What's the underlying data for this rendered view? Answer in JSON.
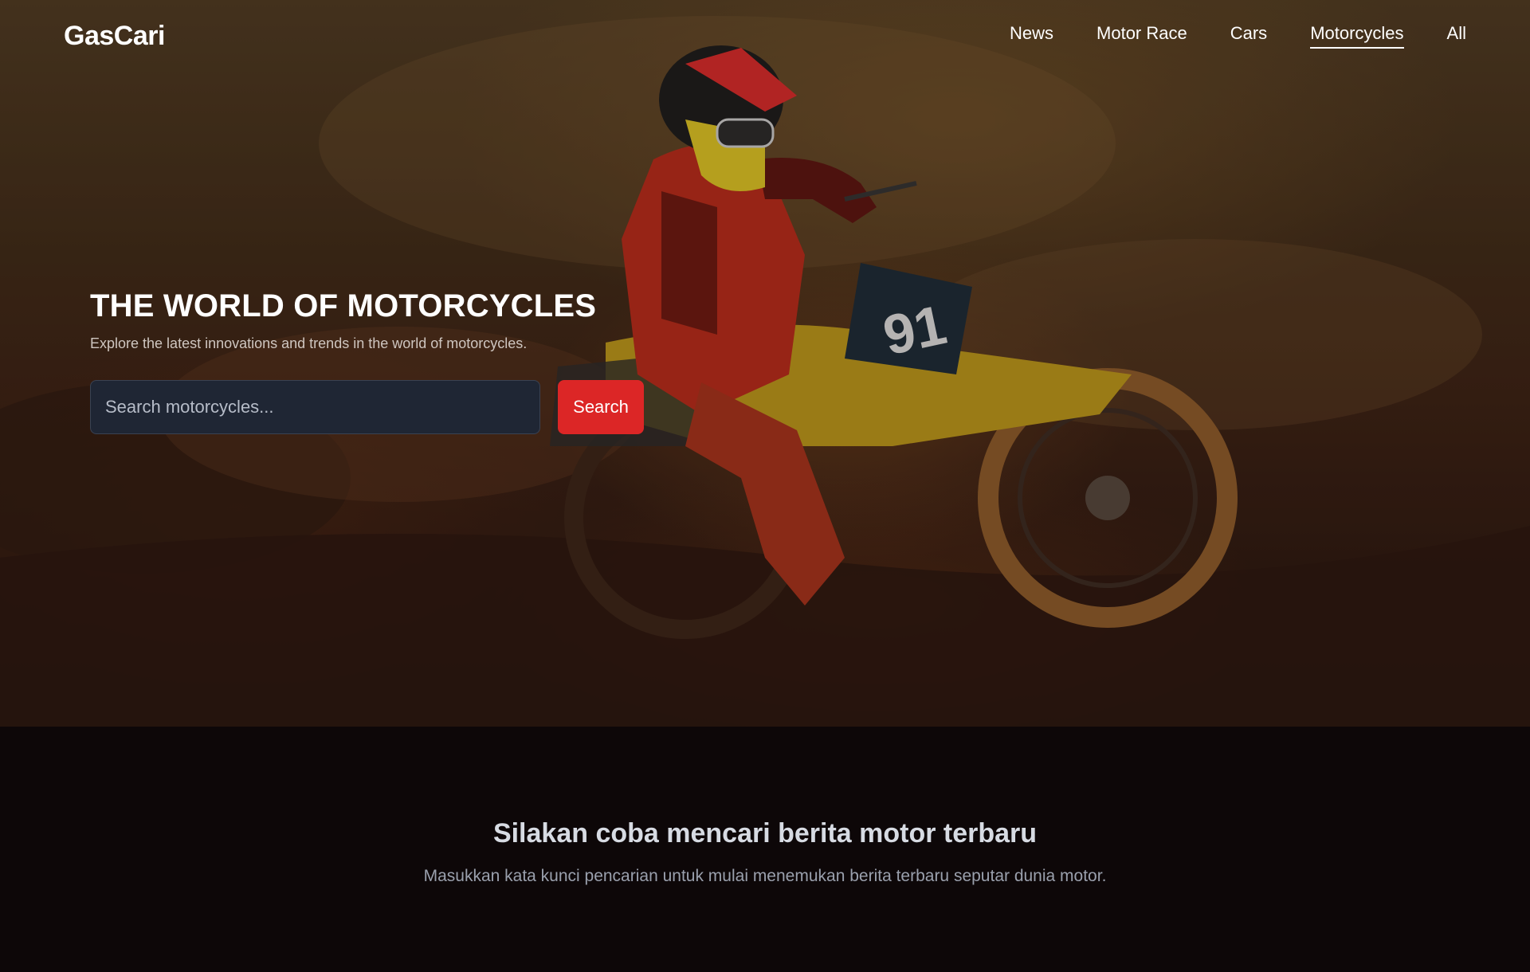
{
  "brand": {
    "logo": "GasCari"
  },
  "nav": {
    "items": [
      {
        "label": "News",
        "active": false
      },
      {
        "label": "Motor Race",
        "active": false
      },
      {
        "label": "Cars",
        "active": false
      },
      {
        "label": "Motorcycles",
        "active": true
      },
      {
        "label": "All",
        "active": false
      }
    ]
  },
  "hero": {
    "title": "THE WORLD OF MOTORCYCLES",
    "subtitle": "Explore the latest innovations and trends in the world of motorcycles.",
    "search": {
      "placeholder": "Search motorcycles...",
      "value": "",
      "button_label": "Search"
    },
    "background_image": "motocross-rider-icon",
    "bike_number": "91"
  },
  "empty_state": {
    "title": "Silakan coba mencari berita motor terbaru",
    "subtitle": "Masukkan kata kunci pencarian untuk mulai menemukan berita terbaru seputar dunia motor."
  },
  "colors": {
    "accent": "#dc2626",
    "page_background": "#0d0708",
    "input_background": "#1f2634"
  }
}
